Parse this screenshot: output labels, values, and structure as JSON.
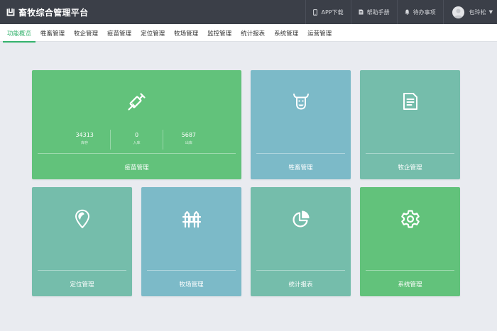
{
  "brand": {
    "title": "畜牧综合管理平台"
  },
  "header": {
    "actions": [
      {
        "label": "APP下载",
        "icon": "phone-icon"
      },
      {
        "label": "帮助手册",
        "icon": "help-doc-icon"
      },
      {
        "label": "待办事项",
        "icon": "bell-icon"
      }
    ],
    "user": {
      "name": "包玲松"
    }
  },
  "nav": {
    "items": [
      "功能概览",
      "牲畜管理",
      "牧企管理",
      "疫苗管理",
      "定位管理",
      "牧场管理",
      "监控管理",
      "统计报表",
      "系统管理",
      "运营管理"
    ],
    "active_index": 0
  },
  "tiles": {
    "vaccine": {
      "label": "疫苗管理",
      "icon": "syringe-icon",
      "stats": [
        {
          "value": "34313",
          "label": "库存"
        },
        {
          "value": "0",
          "label": "入库"
        },
        {
          "value": "5687",
          "label": "出库"
        }
      ]
    },
    "livestock": {
      "label": "牲畜管理",
      "icon": "cow-icon"
    },
    "enterprise": {
      "label": "牧企管理",
      "icon": "document-icon"
    },
    "location": {
      "label": "定位管理",
      "icon": "location-pin-icon"
    },
    "ranch": {
      "label": "牧场管理",
      "icon": "fence-icon"
    },
    "stats": {
      "label": "统计报表",
      "icon": "pie-chart-icon"
    },
    "system": {
      "label": "系统管理",
      "icon": "gear-icon"
    }
  },
  "colors": {
    "topbar": "#3b3f48",
    "accent": "#34b26d",
    "tile_green": "#62c27b",
    "tile_blue": "#7cbac8",
    "tile_teal": "#75bdab",
    "page_bg": "#e9ebf0"
  }
}
